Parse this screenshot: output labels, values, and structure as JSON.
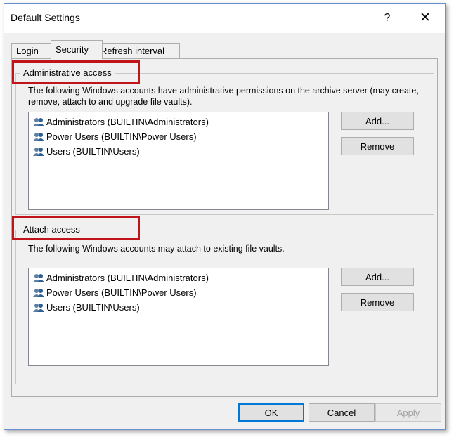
{
  "window": {
    "title": "Default Settings",
    "help_label": "?",
    "close_label": "✕"
  },
  "tabs": [
    {
      "label": "Login"
    },
    {
      "label": "Security",
      "selected": true
    },
    {
      "label": "Refresh interval"
    }
  ],
  "administrative": {
    "legend": "Administrative access",
    "description": "The following Windows accounts have administrative permissions on the archive server (may create, remove, attach to and upgrade file vaults).",
    "accounts": [
      {
        "label": "Administrators (BUILTIN\\Administrators)",
        "icon": "user-group-icon"
      },
      {
        "label": "Power Users (BUILTIN\\Power Users)",
        "icon": "user-group-icon"
      },
      {
        "label": "Users (BUILTIN\\Users)",
        "icon": "user-group-icon"
      }
    ],
    "add_label": "Add...",
    "remove_label": "Remove"
  },
  "attach": {
    "legend": "Attach access",
    "description": "The following Windows accounts may attach to existing file vaults.",
    "accounts": [
      {
        "label": "Administrators (BUILTIN\\Administrators)",
        "icon": "user-group-icon"
      },
      {
        "label": "Power Users (BUILTIN\\Power Users)",
        "icon": "user-group-icon"
      },
      {
        "label": "Users (BUILTIN\\Users)",
        "icon": "user-group-icon"
      }
    ],
    "add_label": "Add...",
    "remove_label": "Remove"
  },
  "footer": {
    "ok_label": "OK",
    "cancel_label": "Cancel",
    "apply_label": "Apply"
  },
  "colors": {
    "highlight": "#c0141a",
    "window_border": "#6a8fcf",
    "dialog_bg": "#f0f0f0"
  }
}
